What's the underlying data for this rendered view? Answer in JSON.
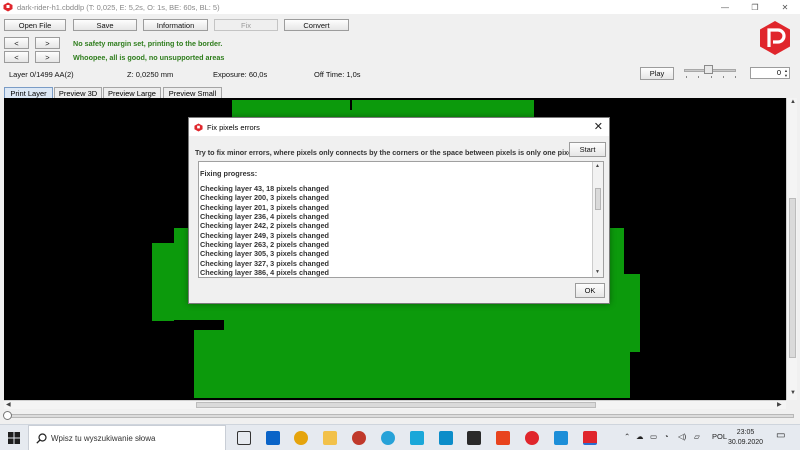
{
  "window": {
    "title": "dark-rider-h1.cbddlp (T: 0,025, E: 5,2s, O: 1s, BE: 60s, BL: 5)",
    "controls": [
      "—",
      "❐",
      "✕"
    ]
  },
  "toolbar": {
    "open_file": "Open File",
    "save": "Save",
    "information": "Information",
    "fix": "Fix",
    "convert": "Convert",
    "prev": "<",
    "next": ">"
  },
  "messages": {
    "margin": "No safety margin set, printing to the border.",
    "supports": "Whoopee, all is good, no unsupported areas"
  },
  "status": {
    "layer": "Layer 0/1499 AA(2)",
    "z": "Z: 0,0250 mm",
    "exposure": "Exposure: 60,0s",
    "off_time": "Off Time: 1,0s"
  },
  "playback": {
    "play_label": "Play",
    "spinner_value": "0"
  },
  "tabs": [
    {
      "label": "Print Layer",
      "active": true
    },
    {
      "label": "Preview 3D",
      "active": false
    },
    {
      "label": "Preview Large",
      "active": false
    },
    {
      "label": "Preview Small",
      "active": false
    }
  ],
  "dialog": {
    "title": "Fix pixels errors",
    "description": "Try to fix minor errors, where pixels only connects by the corners or the space between pixels is only one pixel.",
    "start_label": "Start",
    "ok_label": "OK",
    "log_heading": "Fixing progress:",
    "log_lines": [
      "Checking layer 43, 18 pixels changed",
      "Checking layer 200, 3 pixels changed",
      "Checking layer 201, 3 pixels changed",
      "Checking layer 236, 4 pixels changed",
      "Checking layer 242, 2 pixels changed",
      "Checking layer 249, 3 pixels changed",
      "Checking layer 263, 2 pixels changed",
      "Checking layer 305, 3 pixels changed",
      "Checking layer 327, 3 pixels changed",
      "Checking layer 386, 4 pixels changed"
    ]
  },
  "taskbar": {
    "search_placeholder": "Wpisz tu wyszukiwanie słowa",
    "language": "POL",
    "time": "23:05",
    "date": "30.09.2020"
  },
  "colors": {
    "layer_green": "#0c9a0c",
    "message_green": "#2e7d1c",
    "logo_red": "#e0262c"
  }
}
